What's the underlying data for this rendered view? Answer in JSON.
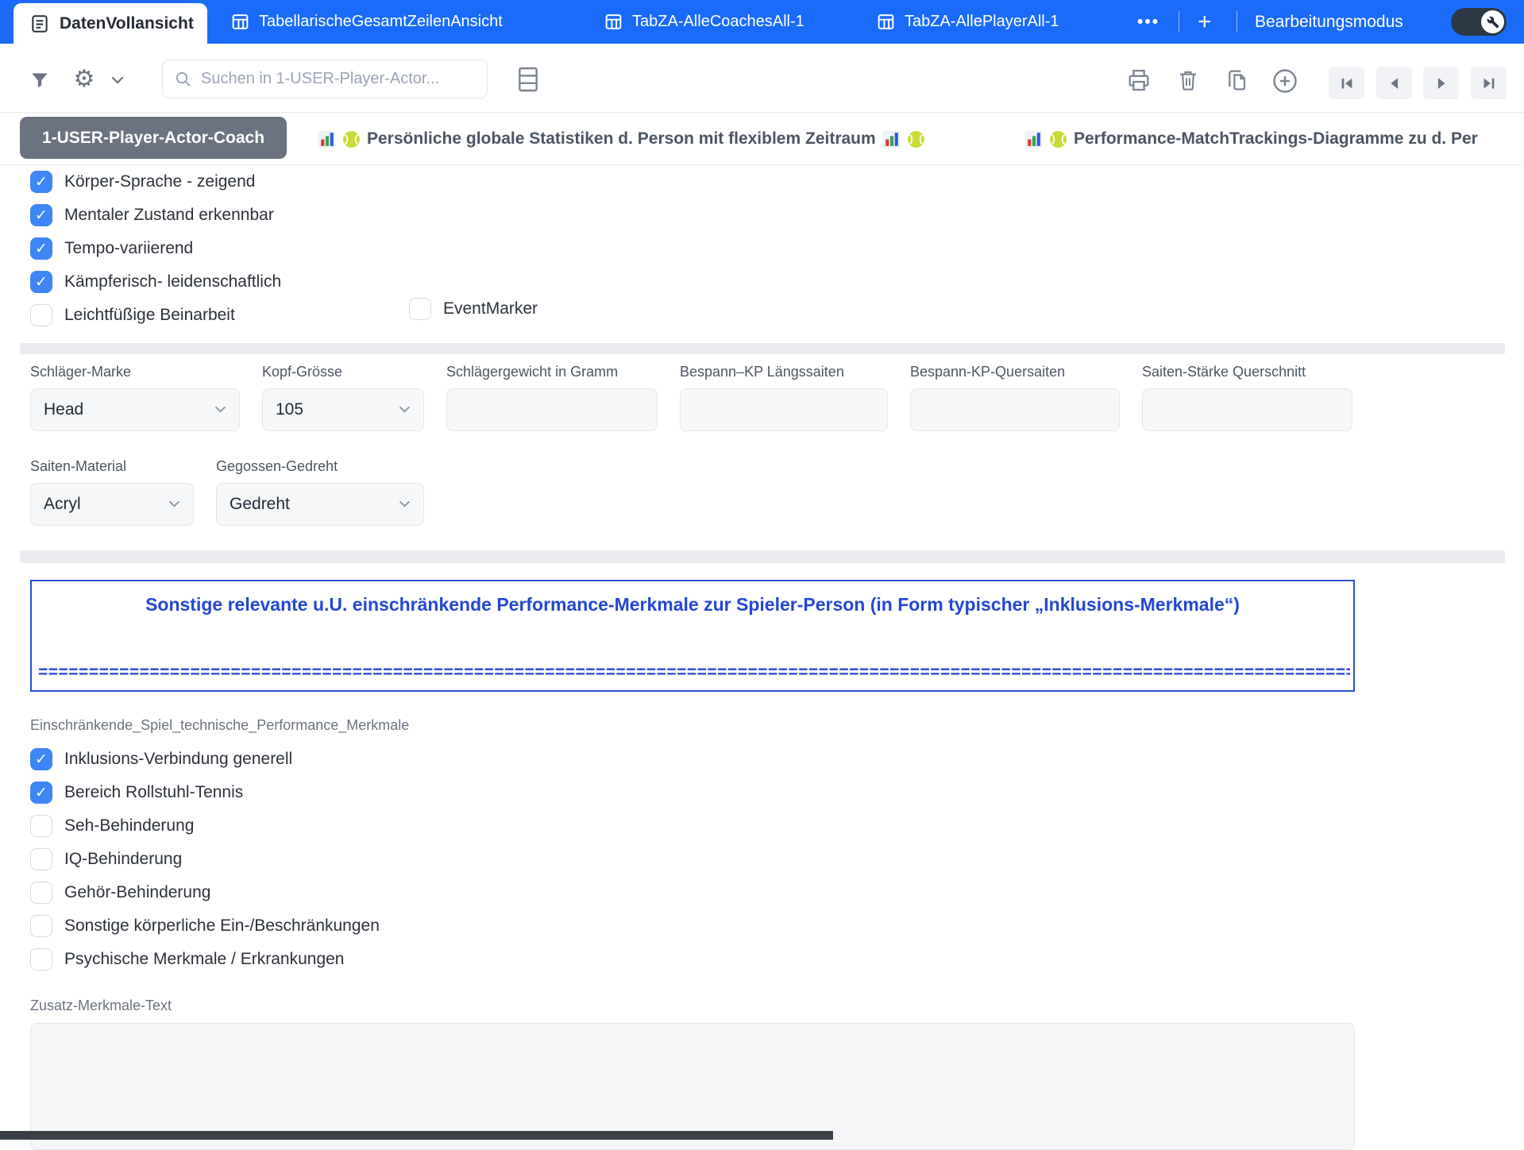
{
  "colors": {
    "header_blue": "#1a6bfa",
    "checkbox_blue": "#3e86f5",
    "notice_blue": "#2447d4",
    "view_button_gray": "#6b7280"
  },
  "icons": {
    "gear_glyph": "⚙"
  },
  "tabbar": {
    "tabs": [
      {
        "label": "DatenVollansicht",
        "active": true
      },
      {
        "label": "TabellarischeGesamtZeilenAnsicht",
        "active": false
      },
      {
        "label": "TabZA-AlleCoachesAll-1",
        "active": false
      },
      {
        "label": "TabZA-AllePlayerAll-1",
        "active": false
      }
    ],
    "more_label": "•••",
    "add_label": "+",
    "edit_mode_label": "Bearbeitungsmodus"
  },
  "toolbar": {
    "search_placeholder": "Suchen in 1-USER-Player-Actor..."
  },
  "viewbar": {
    "active_view": "1-USER-Player-Actor-Coach",
    "link1": "Persönliche globale Statistiken d. Person mit flexiblem Zeitraum",
    "link2": "Performance-MatchTrackings-Diagramme zu d. Per"
  },
  "checks1": {
    "items": [
      {
        "label": "Körper-Sprache - zeigend",
        "checked": true
      },
      {
        "label": "Mentaler Zustand erkennbar",
        "checked": true
      },
      {
        "label": "Tempo-variierend",
        "checked": true
      },
      {
        "label": "Kämpferisch- leidenschaftlich",
        "checked": true
      },
      {
        "label": "Leichtfüßige Beinarbeit",
        "checked": false
      }
    ]
  },
  "eventmarker": {
    "label": "EventMarker",
    "checked": false
  },
  "fields": {
    "row1": [
      {
        "label": "Schläger-Marke",
        "type": "select",
        "value": "Head"
      },
      {
        "label": "Kopf-Grösse",
        "type": "select",
        "value": "105"
      },
      {
        "label": "Schlägergewicht in Gramm",
        "type": "input",
        "value": ""
      },
      {
        "label": "Bespann–KP Längssaiten",
        "type": "input",
        "value": ""
      },
      {
        "label": "Bespann-KP-Quersaiten",
        "type": "input",
        "value": ""
      },
      {
        "label": "Saiten-Stärke Querschnitt",
        "type": "input",
        "value": ""
      }
    ],
    "row2": [
      {
        "label": "Saiten-Material",
        "type": "select",
        "value": "Acryl"
      },
      {
        "label": "Gegossen-Gedreht",
        "type": "select",
        "value": "Gedreht"
      }
    ]
  },
  "notice": {
    "title": "Sonstige relevante u.U. einschränkende Performance-Merkmale zur Spieler-Person (in Form typischer „Inklusions-Merkmale“)",
    "divider": "========================================================================================================================================================================"
  },
  "checks2": {
    "title": "Einschränkende_Spiel_technische_Performance_Merkmale",
    "items": [
      {
        "label": "Inklusions-Verbindung generell",
        "checked": true
      },
      {
        "label": "Bereich Rollstuhl-Tennis",
        "checked": true
      },
      {
        "label": "Seh-Behinderung",
        "checked": false
      },
      {
        "label": "IQ-Behinderung",
        "checked": false
      },
      {
        "label": "Gehör-Behinderung",
        "checked": false
      },
      {
        "label": "Sonstige körperliche Ein-/Beschränkungen",
        "checked": false
      },
      {
        "label": "Psychische Merkmale / Erkrankungen",
        "checked": false
      }
    ]
  },
  "zusatz": {
    "label": "Zusatz-Merkmale-Text",
    "value": ""
  }
}
